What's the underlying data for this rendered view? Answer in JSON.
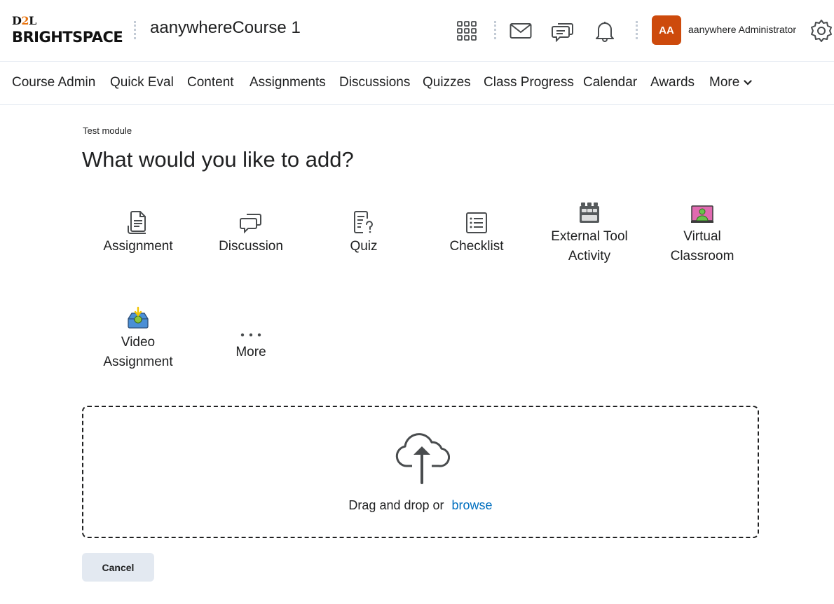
{
  "header": {
    "logo_top_left": "D",
    "logo_top_accent": "2",
    "logo_top_right": "L",
    "logo_bottom": "BRIGHTSPACE",
    "course_title": "aanywhereCourse 1",
    "avatar_initials": "AA",
    "user_name": "aanywhere Administrator",
    "icons": [
      "grid-icon",
      "mail-icon",
      "chat-icon",
      "bell-icon",
      "gear-icon"
    ]
  },
  "nav": {
    "items": [
      "Course Admin",
      "Quick Eval",
      "Content",
      "Assignments",
      "Discussions",
      "Quizzes",
      "Class Progress",
      "Calendar",
      "Awards"
    ],
    "more_label": "More"
  },
  "main": {
    "breadcrumb": "Test module",
    "heading": "What would you like to add?",
    "tiles": [
      {
        "line1": "Assignment",
        "line2": "",
        "icon": "assignment-icon"
      },
      {
        "line1": "Discussion",
        "line2": "",
        "icon": "discussion-icon"
      },
      {
        "line1": "Quiz",
        "line2": "",
        "icon": "quiz-icon"
      },
      {
        "line1": "Checklist",
        "line2": "",
        "icon": "checklist-icon"
      },
      {
        "line1": "External Tool",
        "line2": "Activity",
        "icon": "lego-icon"
      },
      {
        "line1": "Virtual",
        "line2": "Classroom",
        "icon": "virtual-classroom-icon"
      },
      {
        "line1": "Video",
        "line2": "Assignment",
        "icon": "video-inbox-icon"
      },
      {
        "line1": "More",
        "line2": "",
        "icon": "ellipsis-icon"
      }
    ],
    "dropzone": {
      "text": "Drag and drop or",
      "link": "browse"
    },
    "cancel_label": "Cancel"
  },
  "colors": {
    "avatar": "#cd4a0c",
    "link": "#006fbf",
    "logo_accent": "#e87511",
    "button_bg": "#e3e9f1"
  }
}
